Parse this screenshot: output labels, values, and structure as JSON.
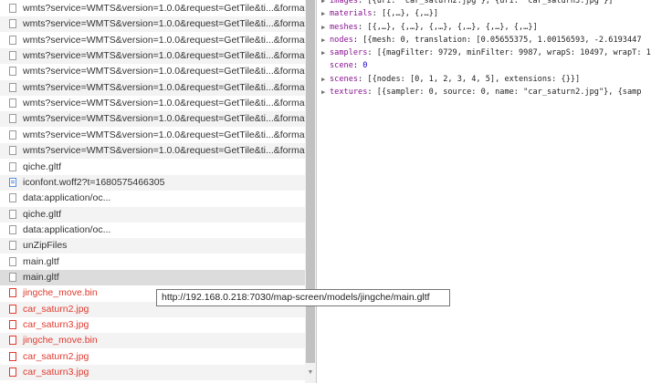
{
  "requests": [
    {
      "label": "wmts?service=WMTS&version=1.0.0&request=GetTile&ti...&format=t",
      "status": "normal",
      "icon": "file-icon"
    },
    {
      "label": "wmts?service=WMTS&version=1.0.0&request=GetTile&ti...&format=t",
      "status": "normal",
      "icon": "file-icon"
    },
    {
      "label": "wmts?service=WMTS&version=1.0.0&request=GetTile&ti...&format=t",
      "status": "normal",
      "icon": "file-icon"
    },
    {
      "label": "wmts?service=WMTS&version=1.0.0&request=GetTile&ti...&format=t",
      "status": "normal",
      "icon": "file-icon"
    },
    {
      "label": "wmts?service=WMTS&version=1.0.0&request=GetTile&ti...&format=t",
      "status": "normal",
      "icon": "file-icon"
    },
    {
      "label": "wmts?service=WMTS&version=1.0.0&request=GetTile&ti...&format=t",
      "status": "normal",
      "icon": "file-icon"
    },
    {
      "label": "wmts?service=WMTS&version=1.0.0&request=GetTile&ti...&format=t",
      "status": "normal",
      "icon": "file-icon"
    },
    {
      "label": "wmts?service=WMTS&version=1.0.0&request=GetTile&ti...&format=t",
      "status": "normal",
      "icon": "file-icon"
    },
    {
      "label": "wmts?service=WMTS&version=1.0.0&request=GetTile&ti...&format=t",
      "status": "normal",
      "icon": "file-icon"
    },
    {
      "label": "wmts?service=WMTS&version=1.0.0&request=GetTile&ti...&format=t",
      "status": "normal",
      "icon": "file-icon"
    },
    {
      "label": "qiche.gltf",
      "status": "normal",
      "icon": "file-icon"
    },
    {
      "label": "iconfont.woff2?t=1680575466305",
      "status": "normal",
      "icon": "font-file-icon"
    },
    {
      "label": "data:application/oc...",
      "status": "normal",
      "icon": "file-icon"
    },
    {
      "label": "qiche.gltf",
      "status": "normal",
      "icon": "file-icon"
    },
    {
      "label": "data:application/oc...",
      "status": "normal",
      "icon": "file-icon"
    },
    {
      "label": "unZipFiles",
      "status": "normal",
      "icon": "file-icon"
    },
    {
      "label": "main.gltf",
      "status": "normal",
      "icon": "file-icon"
    },
    {
      "label": "main.gltf",
      "status": "selected",
      "icon": "file-icon"
    },
    {
      "label": "jingche_move.bin",
      "status": "error",
      "icon": "file-icon"
    },
    {
      "label": "car_saturn2.jpg",
      "status": "error",
      "icon": "file-icon"
    },
    {
      "label": "car_saturn3.jpg",
      "status": "error",
      "icon": "file-icon"
    },
    {
      "label": "jingche_move.bin",
      "status": "error",
      "icon": "file-icon"
    },
    {
      "label": "car_saturn2.jpg",
      "status": "error",
      "icon": "file-icon"
    },
    {
      "label": "car_saturn3.jpg",
      "status": "error",
      "icon": "file-icon"
    }
  ],
  "tooltip": "http://192.168.0.218:7030/map-screen/models/jingche/main.gltf",
  "preview": [
    {
      "key": "images",
      "value": "[{uri: \"car_saturn2.jpg\"}, {uri: \"car_saturn3.jpg\"}]",
      "expandable": true
    },
    {
      "key": "materials",
      "value": "[{,…}, {,…}]",
      "expandable": true
    },
    {
      "key": "meshes",
      "value": "[{,…}, {,…}, {,…}, {,…}, {,…}, {,…}]",
      "expandable": true
    },
    {
      "key": "nodes",
      "value": "[{mesh: 0, translation: [0.05655375, 1.00156593, -2.6193447",
      "expandable": true
    },
    {
      "key": "samplers",
      "value": "[{magFilter: 9729, minFilter: 9987, wrapS: 10497, wrapT: 1",
      "expandable": true
    },
    {
      "key": "scene",
      "value": "0",
      "expandable": false
    },
    {
      "key": "scenes",
      "value": "[{nodes: [0, 1, 2, 3, 4, 5], extensions: {}}]",
      "expandable": true
    },
    {
      "key": "textures",
      "value": "[{sampler: 0, source: 0, name: \"car_saturn2.jpg\"}, {samp",
      "expandable": true
    }
  ],
  "colors": {
    "error": "#e03a2f",
    "selected": "#dcdcdc",
    "key": "#881391",
    "number": "#1c00cf",
    "string": "#c41a16"
  }
}
